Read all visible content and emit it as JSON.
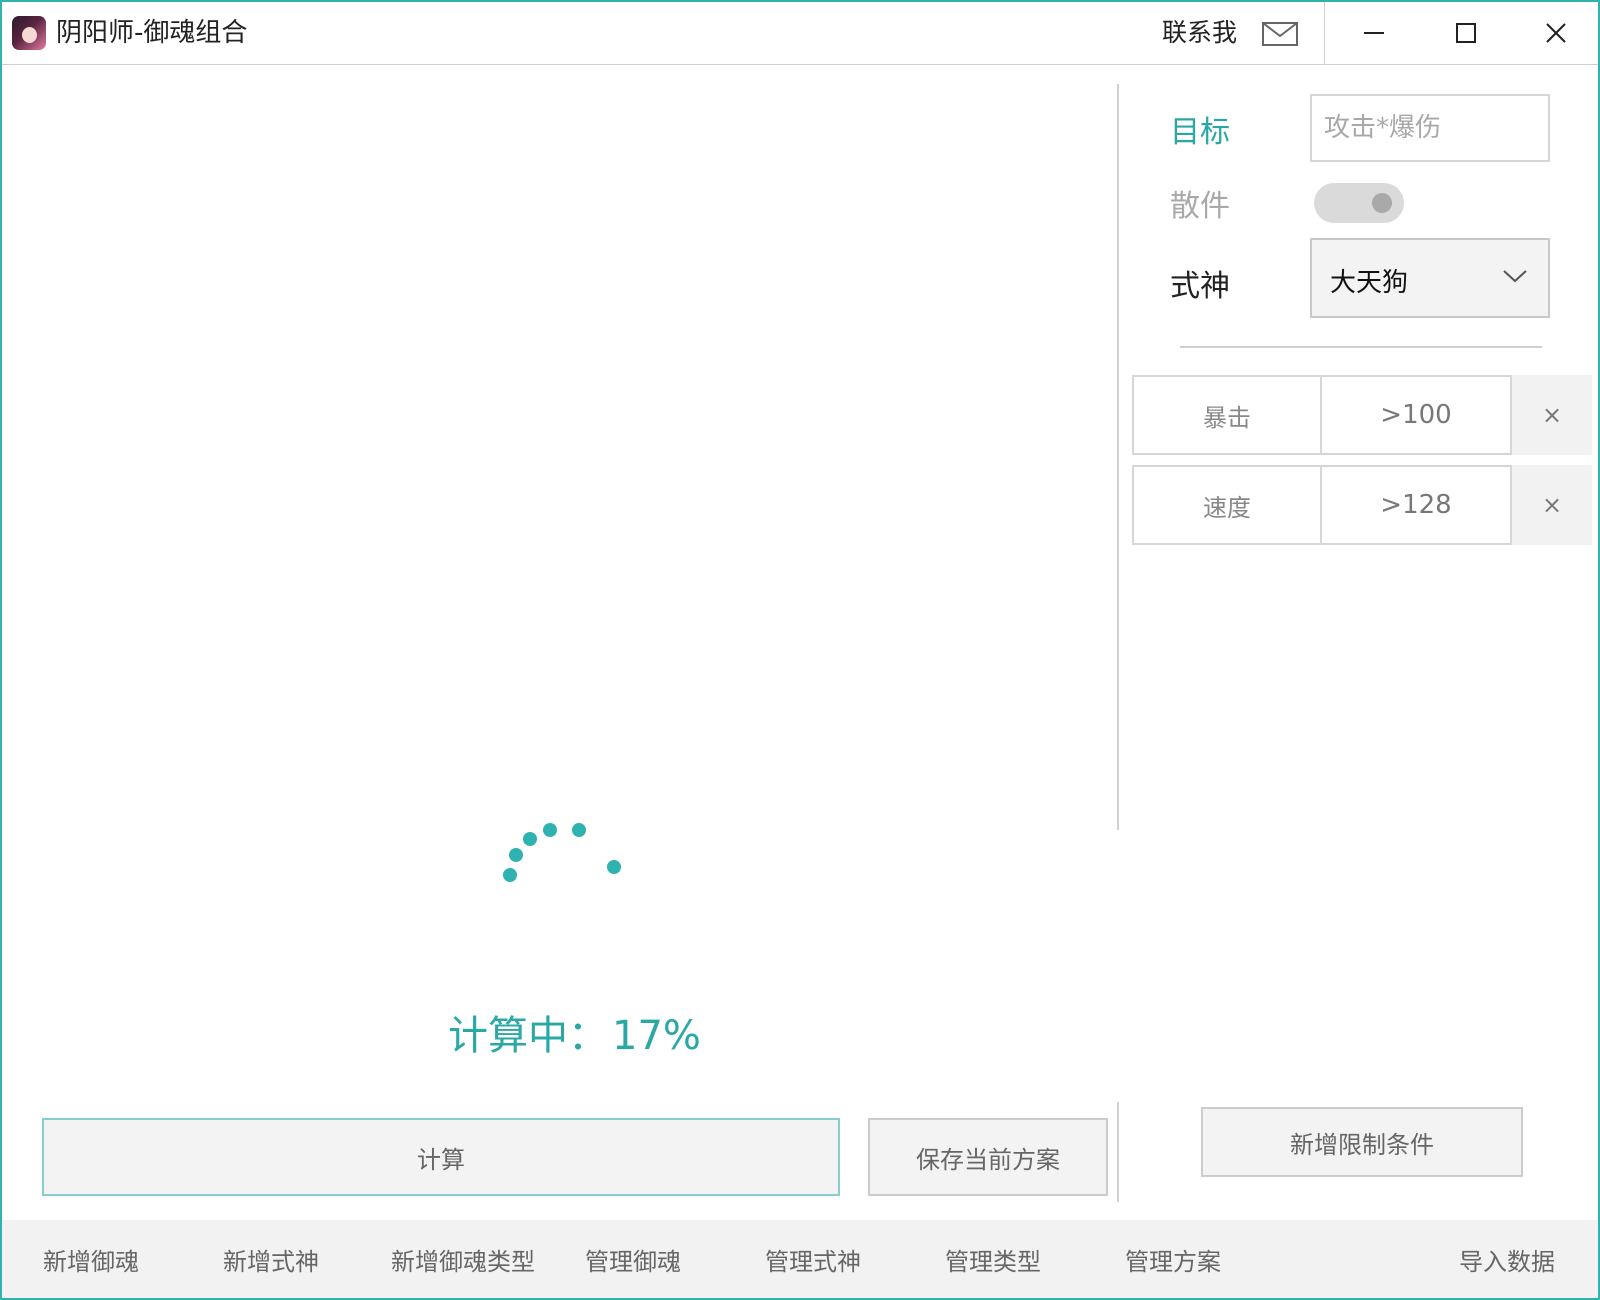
{
  "window": {
    "title": "阴阳师-御魂组合",
    "contact_label": "联系我",
    "accent_color": "#2fb3b0"
  },
  "main": {
    "progress_label": "计算中：",
    "progress_value": "17%",
    "progress_fraction": 0.17,
    "calc_button": "计算",
    "save_button": "保存当前方案"
  },
  "panel": {
    "target_label": "目标",
    "target_placeholder": "攻击*爆伤",
    "loose_label": "散件",
    "loose_enabled": false,
    "shiki_label": "式神",
    "shiki_selected": "大天狗",
    "conditions": [
      {
        "name": "暴击",
        "value": ">100",
        "remove": "×"
      },
      {
        "name": "速度",
        "value": ">128",
        "remove": "×"
      }
    ],
    "add_condition_button": "新增限制条件"
  },
  "nav": {
    "items": [
      "新增御魂",
      "新增式神",
      "新增御魂类型",
      "管理御魂",
      "管理式神",
      "管理类型",
      "管理方案"
    ],
    "import_label": "导入数据"
  },
  "icons": {
    "mail": "mail-icon",
    "minimize": "minimize-icon",
    "maximize": "maximize-icon",
    "close": "close-icon",
    "dropdown": "chevron-down-icon",
    "spinner": "loading-spinner-icon"
  }
}
